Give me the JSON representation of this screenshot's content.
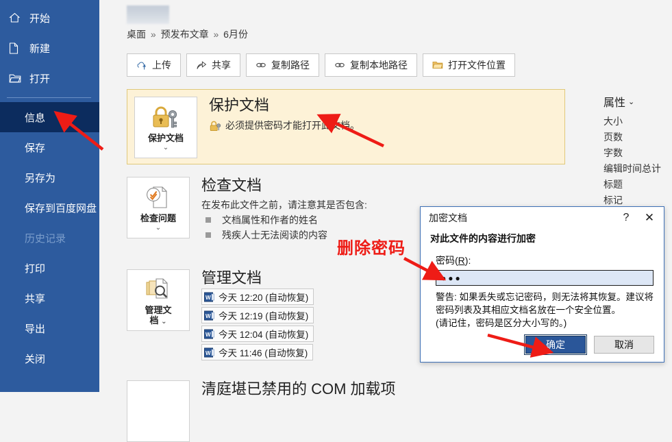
{
  "app": {
    "accent": "#2d5b9e",
    "accent_dark": "#0c2c5e",
    "annotation_color": "#ee1c16"
  },
  "sidebar": {
    "top_items": [
      {
        "label": "开始",
        "icon": "home-icon"
      },
      {
        "label": "新建",
        "icon": "new-document-icon"
      },
      {
        "label": "打开",
        "icon": "open-folder-icon"
      }
    ],
    "items": [
      {
        "label": "信息",
        "selected": true,
        "disabled": false
      },
      {
        "label": "保存",
        "selected": false,
        "disabled": false
      },
      {
        "label": "另存为",
        "selected": false,
        "disabled": false
      },
      {
        "label": "保存到百度网盘",
        "selected": false,
        "disabled": false
      },
      {
        "label": "历史记录",
        "selected": false,
        "disabled": true
      },
      {
        "label": "打印",
        "selected": false,
        "disabled": false
      },
      {
        "label": "共享",
        "selected": false,
        "disabled": false
      },
      {
        "label": "导出",
        "selected": false,
        "disabled": false
      },
      {
        "label": "关闭",
        "selected": false,
        "disabled": false
      }
    ]
  },
  "header": {
    "document_title_redacted": true,
    "breadcrumb": [
      "桌面",
      "预发布文章",
      "6月份"
    ],
    "breadcrumb_separator": "»"
  },
  "toolbar": {
    "buttons": [
      {
        "label": "上传",
        "icon": "cloud-upload-icon"
      },
      {
        "label": "共享",
        "icon": "share-icon"
      },
      {
        "label": "复制路径",
        "icon": "link-icon"
      },
      {
        "label": "复制本地路径",
        "icon": "link-icon"
      },
      {
        "label": "打开文件位置",
        "icon": "folder-open-icon"
      }
    ]
  },
  "sections": {
    "protect": {
      "button_label": "保护文档",
      "button_icon": "padlock-key-icon",
      "heading": "保护文档",
      "status_icon": "padlock-small-icon",
      "status_text": "必须提供密码才能打开此文档。",
      "bg": "#fdf2d7",
      "border": "#e0c87a"
    },
    "inspect": {
      "button_label": "检查问题",
      "button_icon": "document-check-icon",
      "heading": "检查文档",
      "subtitle": "在发布此文件之前，请注意其是否包含:",
      "bullets": [
        "文档属性和作者的姓名",
        "残疾人士无法阅读的内容"
      ]
    },
    "manage": {
      "button_label": "管理文\n档",
      "button_label_line1": "管理文",
      "button_label_line2": "档",
      "button_icon": "document-search-icon",
      "heading": "管理文档",
      "recovery_items": [
        {
          "label": "今天 12:20 (自动恢复)",
          "icon": "word-file-icon"
        },
        {
          "label": "今天 12:19 (自动恢复)",
          "icon": "word-file-icon"
        },
        {
          "label": "今天 12:04 (自动恢复)",
          "icon": "word-file-icon"
        },
        {
          "label": "今天 11:46 (自动恢复)",
          "icon": "word-file-icon"
        }
      ]
    },
    "addin": {
      "heading": "清庭堪已禁用的 COM 加载项"
    }
  },
  "properties": {
    "heading": "属性",
    "rows": [
      "大小",
      "页数",
      "字数",
      "编辑时间总计",
      "标题",
      "标记"
    ]
  },
  "dialog": {
    "title": "加密文档",
    "help_glyph": "?",
    "close_glyph": "✕",
    "heading": "对此文件的内容进行加密",
    "password_label_prefix": "密码(",
    "password_label_key": "R",
    "password_label_suffix": "):",
    "password_value": "●●●",
    "warning": "警告: 如果丢失或忘记密码，则无法将其恢复。建议将密码列表及其相应文档名放在一个安全位置。\n(请记住，密码是区分大小写的。)",
    "warning_line1": "警告: 如果丢失或忘记密码，则无法将其恢复。建议将",
    "warning_line2": "密码列表及其相应文档名放在一个安全位置。",
    "warning_line3": "(请记住，密码是区分大小写的。)",
    "ok_label": "确定",
    "cancel_label": "取消"
  },
  "annotations": {
    "delete_password_text": "删除密码",
    "arrows": [
      {
        "name": "arrow-to-info-tab"
      },
      {
        "name": "arrow-to-protect-status"
      },
      {
        "name": "arrow-to-password-input"
      },
      {
        "name": "arrow-to-ok-button"
      }
    ]
  }
}
